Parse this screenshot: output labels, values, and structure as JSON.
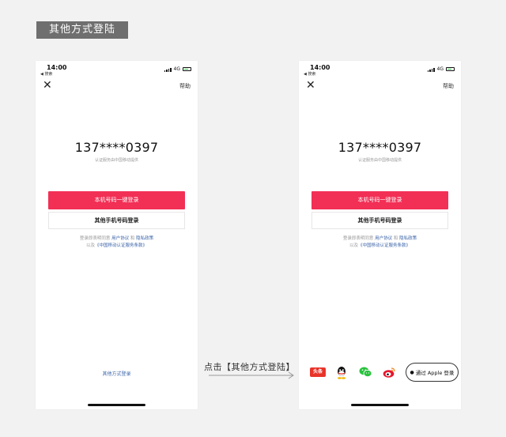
{
  "section_title": "其他方式登陆",
  "step": {
    "label": "点击【其他方式登陆】"
  },
  "screens": [
    {
      "status": {
        "time": "14:00",
        "back": "◀ 搜索",
        "network": "4G"
      },
      "close_glyph": "✕",
      "help": "帮助",
      "phone_number": "137****0397",
      "provider": "认证服务由中国移动提供",
      "primary_button": "本机号码一键登录",
      "secondary_button": "其他手机号码登录",
      "agreement": {
        "prefix": "登录即表明同意",
        "user_agreement": "用户协议",
        "and": "和",
        "privacy": "隐私政策",
        "line2_prefix": "以及",
        "cmcc_terms": "《中国移动认证服务条款》"
      },
      "other_login": "其他方式登录"
    },
    {
      "status": {
        "time": "14:00",
        "back": "◀ 搜索",
        "network": "4G"
      },
      "close_glyph": "✕",
      "help": "帮助",
      "phone_number": "137****0397",
      "provider": "认证服务由中国移动提供",
      "primary_button": "本机号码一键登录",
      "secondary_button": "其他手机号码登录",
      "agreement": {
        "prefix": "登录即表明同意",
        "user_agreement": "用户协议",
        "and": "和",
        "privacy": "隐私政策",
        "line2_prefix": "以及",
        "cmcc_terms": "《中国移动认证服务条款》"
      },
      "social": {
        "toutiao": "头条",
        "icons": [
          "toutiao-icon",
          "qq-icon",
          "wechat-icon",
          "weibo-icon"
        ],
        "apple_label": "通过 Apple 登录",
        "apple_glyph": ""
      }
    }
  ],
  "colors": {
    "primary": "#f22f55",
    "link": "#3a63a8",
    "toutiao": "#e8342a",
    "wechat": "#2ac23e",
    "weibo": "#e6162d",
    "arrow": "#999999"
  }
}
